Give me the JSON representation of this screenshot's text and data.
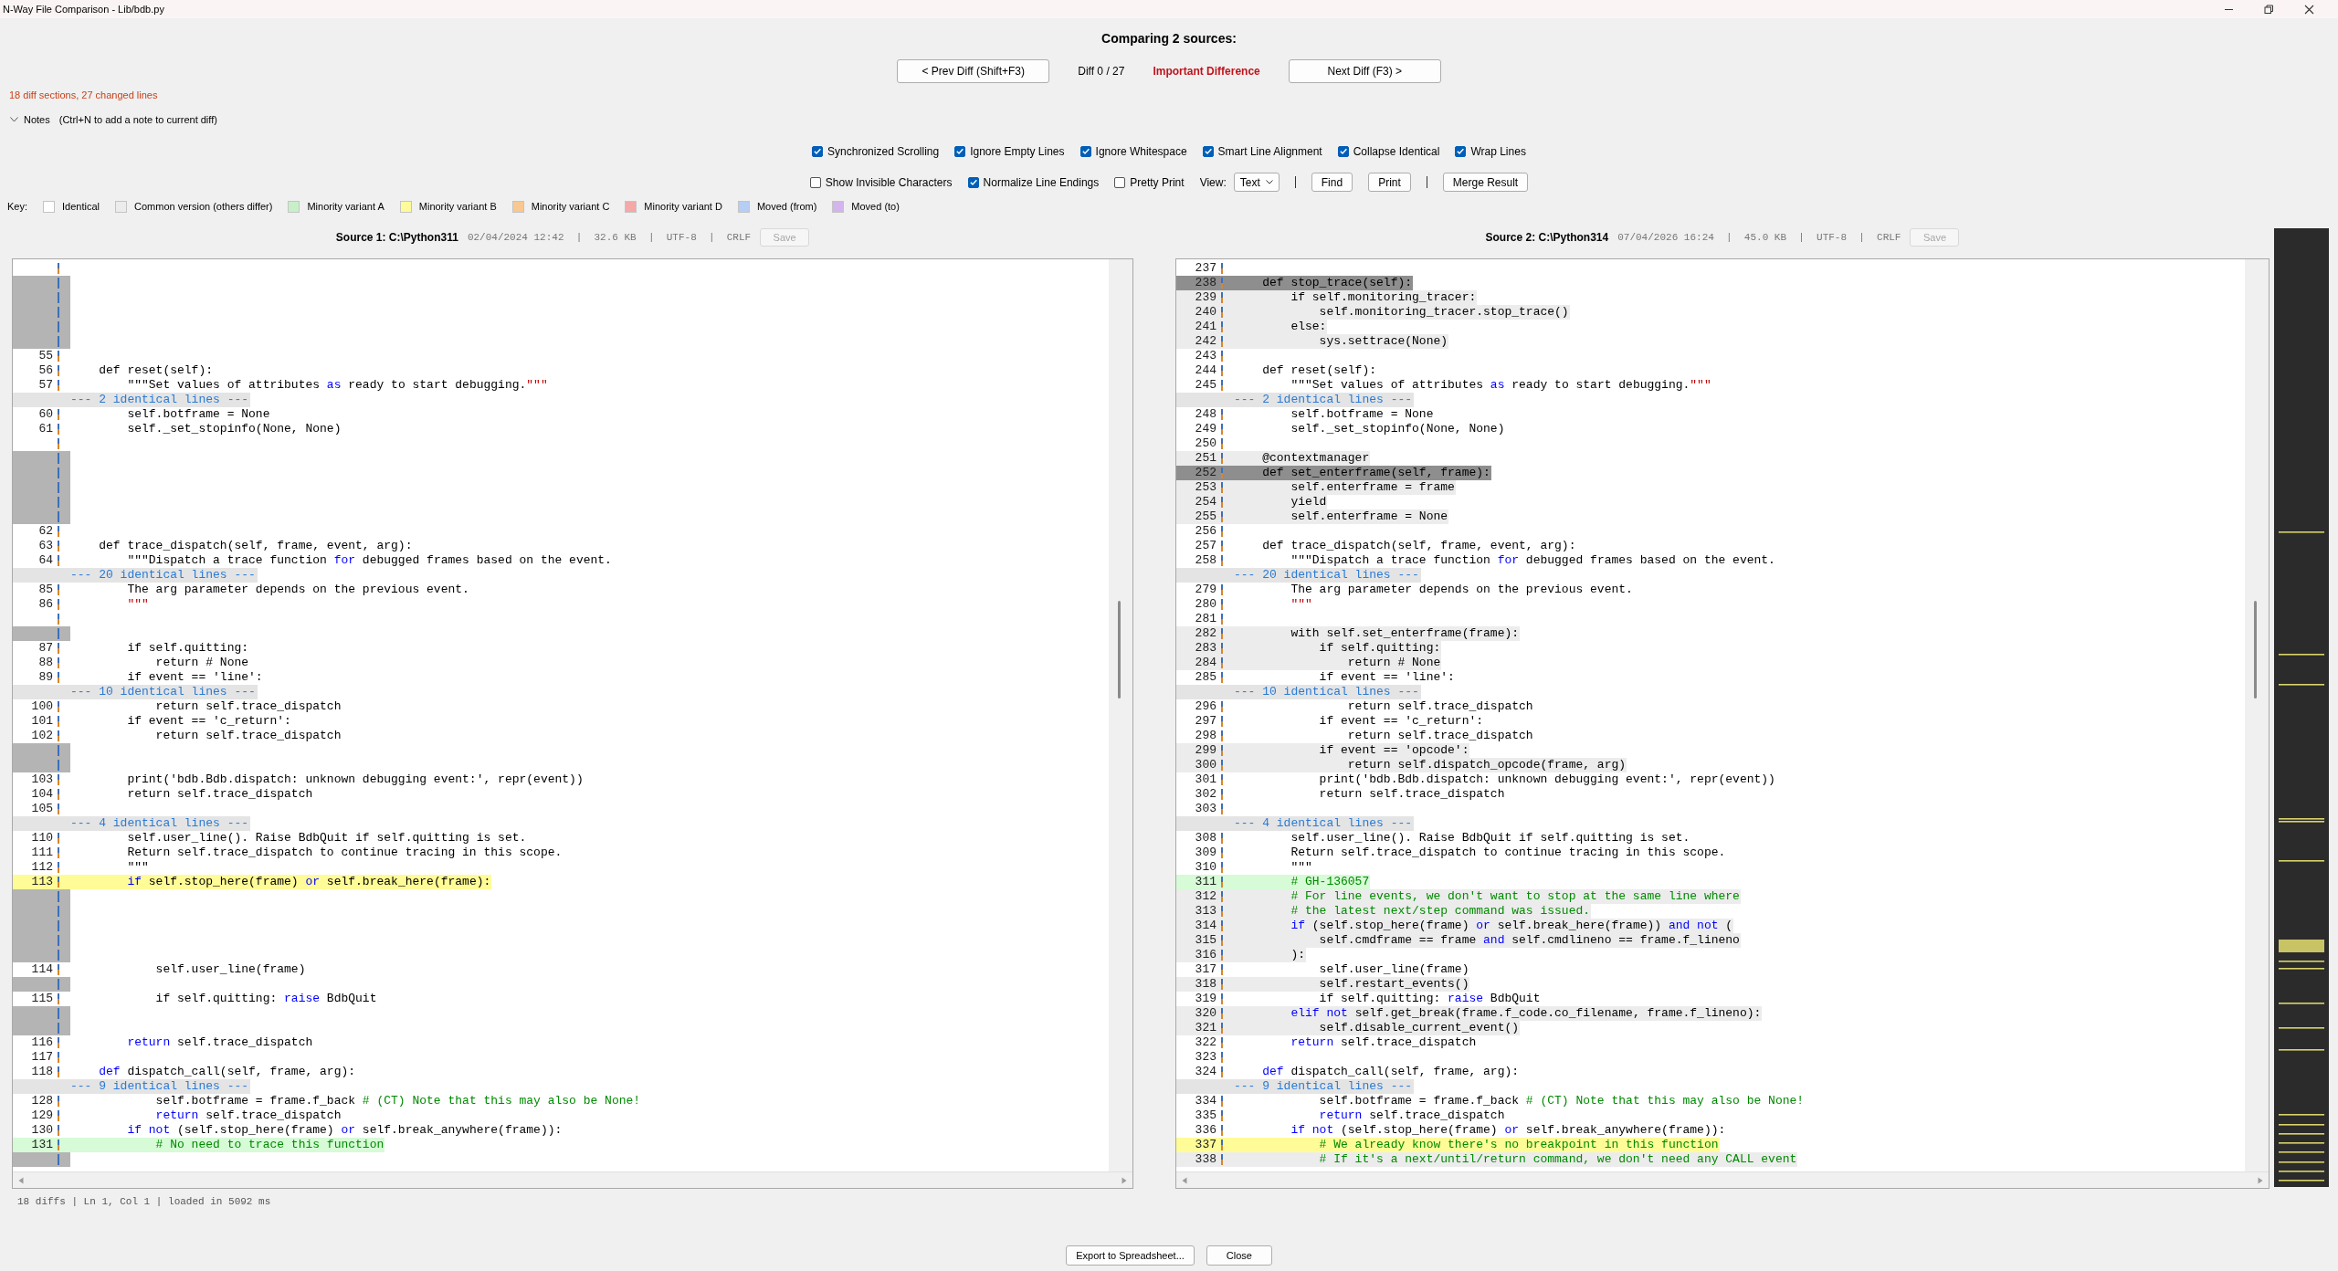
{
  "window": {
    "title": "N-Way File Comparison - Lib/bdb.py"
  },
  "header": {
    "title": "Comparing 2 sources:",
    "prev_button": "< Prev Diff  (Shift+F3)",
    "diff_counter": "Diff 0 / 27",
    "importance": "Important Difference",
    "next_button": "Next Diff (F3)  >"
  },
  "summary": "18 diff sections, 27 changed lines",
  "notes": {
    "label": "Notes",
    "hint": "(Ctrl+N to add a note to current diff)"
  },
  "options_row1": [
    {
      "label": "Synchronized Scrolling",
      "checked": true
    },
    {
      "label": "Ignore Empty Lines",
      "checked": true
    },
    {
      "label": "Ignore Whitespace",
      "checked": true
    },
    {
      "label": "Smart Line Alignment",
      "checked": true
    },
    {
      "label": "Collapse Identical",
      "checked": true
    },
    {
      "label": "Wrap Lines",
      "checked": true
    }
  ],
  "options_row2": [
    {
      "label": "Show Invisible Characters",
      "checked": false
    },
    {
      "label": "Normalize Line Endings",
      "checked": true
    },
    {
      "label": "Pretty Print",
      "checked": false
    }
  ],
  "view": {
    "label": "View:",
    "value": "Text"
  },
  "tool_buttons": [
    "Find",
    "Print",
    "Merge Result"
  ],
  "key": {
    "label": "Key:",
    "items": [
      {
        "label": "Identical",
        "color": "#ffffff"
      },
      {
        "label": "Common version (others differ)",
        "color": "#ececec"
      },
      {
        "label": "Minority variant A",
        "color": "#c8f0c8"
      },
      {
        "label": "Minority variant B",
        "color": "#fffa9a"
      },
      {
        "label": "Minority variant C",
        "color": "#f8c890"
      },
      {
        "label": "Minority variant D",
        "color": "#f4a8a8"
      },
      {
        "label": "Moved (from)",
        "color": "#b4cef4"
      },
      {
        "label": "Moved (to)",
        "color": "#d4b4ec"
      }
    ]
  },
  "sources": [
    {
      "title": "Source 1: C:\\Python311",
      "meta": "02/04/2024 12:42  |  32.6 KB  |  UTF-8  |  CRLF",
      "save": {
        "label": "Save",
        "disabled": true
      },
      "rows": [
        {
          "kind": "blank"
        },
        {
          "kind": "gap"
        },
        {
          "kind": "gap"
        },
        {
          "kind": "gap"
        },
        {
          "kind": "gap"
        },
        {
          "kind": "gap"
        },
        {
          "kind": "line",
          "number": "55"
        },
        {
          "kind": "line",
          "number": "56",
          "code": "    def reset(self):"
        },
        {
          "kind": "line",
          "number": "57",
          "parts": [
            {
              "text": "        \"\"\"Set values of attributes "
            },
            {
              "text": "as",
              "kind": "keyword"
            },
            {
              "text": " ready to start debugging."
            },
            {
              "text": "\"\"\"",
              "kind": "string"
            }
          ]
        },
        {
          "kind": "collapsed",
          "text": "--- 2 identical lines ---"
        },
        {
          "kind": "line",
          "number": "60",
          "code": "        self.botframe = None"
        },
        {
          "kind": "line",
          "number": "61",
          "code": "        self._set_stopinfo(None, None)"
        },
        {
          "kind": "blank"
        },
        {
          "kind": "gap"
        },
        {
          "kind": "gap"
        },
        {
          "kind": "gap"
        },
        {
          "kind": "gap"
        },
        {
          "kind": "gap"
        },
        {
          "kind": "line",
          "number": "62"
        },
        {
          "kind": "line",
          "number": "63",
          "code": "    def trace_dispatch(self, frame, event, arg):"
        },
        {
          "kind": "line",
          "number": "64",
          "parts": [
            {
              "text": "        \"\"\"Dispatch a trace function "
            },
            {
              "text": "for",
              "kind": "keyword"
            },
            {
              "text": " debugged frames based on the event."
            }
          ]
        },
        {
          "kind": "collapsed",
          "text": "--- 20 identical lines ---"
        },
        {
          "kind": "line",
          "number": "85",
          "code": "        The arg parameter depends on the previous event."
        },
        {
          "kind": "line",
          "number": "86",
          "parts": [
            {
              "text": "        \"\"\"",
              "kind": "string"
            }
          ]
        },
        {
          "kind": "blank"
        },
        {
          "kind": "gap"
        },
        {
          "kind": "line",
          "number": "87",
          "code": "        if self.quitting:"
        },
        {
          "kind": "line",
          "number": "88",
          "code": "            return # None"
        },
        {
          "kind": "line",
          "number": "89",
          "code": "        if event == 'line':"
        },
        {
          "kind": "collapsed",
          "text": "--- 10 identical lines ---"
        },
        {
          "kind": "line",
          "number": "100",
          "code": "            return self.trace_dispatch"
        },
        {
          "kind": "line",
          "number": "101",
          "code": "        if event == 'c_return':"
        },
        {
          "kind": "line",
          "number": "102",
          "code": "            return self.trace_dispatch"
        },
        {
          "kind": "gap"
        },
        {
          "kind": "gap"
        },
        {
          "kind": "line",
          "number": "103",
          "code": "        print('bdb.Bdb.dispatch: unknown debugging event:', repr(event))"
        },
        {
          "kind": "line",
          "number": "104",
          "code": "        return self.trace_dispatch"
        },
        {
          "kind": "line",
          "number": "105"
        },
        {
          "kind": "collapsed",
          "text": "--- 4 identical lines ---"
        },
        {
          "kind": "line",
          "number": "110",
          "code": "        self.user_line(). Raise BdbQuit if self.quitting is set."
        },
        {
          "kind": "line",
          "number": "111",
          "code": "        Return self.trace_dispatch to continue tracing in this scope."
        },
        {
          "kind": "line",
          "number": "112",
          "code": "        \"\"\""
        },
        {
          "kind": "variant-b-line",
          "number": "113",
          "parts": [
            {
              "text": "        if",
              "kind": "keyword"
            },
            {
              "text": " self.stop_here(frame) "
            },
            {
              "text": "or",
              "kind": "keyword"
            },
            {
              "text": " self.break_here(frame):"
            }
          ]
        },
        {
          "kind": "gap"
        },
        {
          "kind": "gap"
        },
        {
          "kind": "gap"
        },
        {
          "kind": "gap"
        },
        {
          "kind": "gap"
        },
        {
          "kind": "line",
          "number": "114",
          "code": "            self.user_line(frame)"
        },
        {
          "kind": "gap"
        },
        {
          "kind": "line",
          "number": "115",
          "parts": [
            {
              "text": "            if self.quitting: "
            },
            {
              "text": "raise",
              "kind": "keyword"
            },
            {
              "text": " BdbQuit"
            }
          ]
        },
        {
          "kind": "gap"
        },
        {
          "kind": "gap"
        },
        {
          "kind": "line",
          "number": "116",
          "parts": [
            {
              "text": "        return",
              "kind": "keyword"
            },
            {
              "text": " self.trace_dispatch"
            }
          ]
        },
        {
          "kind": "line",
          "number": "117"
        },
        {
          "kind": "line",
          "number": "118",
          "parts": [
            {
              "text": "    def",
              "kind": "keyword"
            },
            {
              "text": " dispatch_call(self, frame, arg):"
            }
          ]
        },
        {
          "kind": "collapsed",
          "text": "--- 9 identical lines ---"
        },
        {
          "kind": "line",
          "number": "128",
          "parts": [
            {
              "text": "            self.botframe = frame.f_back "
            },
            {
              "text": "# (CT) Note that this may also be None!",
              "kind": "comment"
            }
          ]
        },
        {
          "kind": "line",
          "number": "129",
          "parts": [
            {
              "text": "            return",
              "kind": "keyword"
            },
            {
              "text": " self.trace_dispatch"
            }
          ]
        },
        {
          "kind": "line",
          "number": "130",
          "parts": [
            {
              "text": "        if not",
              "kind": "keyword"
            },
            {
              "text": " (self.stop_here(frame) "
            },
            {
              "text": "or",
              "kind": "keyword"
            },
            {
              "text": " self.break_anywhere(frame)):"
            }
          ]
        },
        {
          "kind": "variant-a-line",
          "number": "131",
          "parts": [
            {
              "text": "            # No need to trace this function",
              "kind": "comment"
            }
          ]
        },
        {
          "kind": "gap"
        }
      ]
    },
    {
      "title": "Source 2: C:\\Python314",
      "meta": "07/04/2026 16:24  |  45.0 KB  |  UTF-8  |  CRLF",
      "save": {
        "label": "Save",
        "disabled": true
      },
      "rows": [
        {
          "kind": "line",
          "number": "237"
        },
        {
          "kind": "current-line",
          "number": "238",
          "code": "    def stop_trace(self):"
        },
        {
          "kind": "changed-line",
          "number": "239",
          "code": "        if self.monitoring_tracer:"
        },
        {
          "kind": "changed-line",
          "number": "240",
          "code": "            self.monitoring_tracer.stop_trace()"
        },
        {
          "kind": "changed-line",
          "number": "241",
          "code": "        else:"
        },
        {
          "kind": "changed-line",
          "number": "242",
          "code": "            sys.settrace(None)"
        },
        {
          "kind": "line",
          "number": "243"
        },
        {
          "kind": "line",
          "number": "244",
          "code": "    def reset(self):"
        },
        {
          "kind": "line",
          "number": "245",
          "parts": [
            {
              "text": "        \"\"\"Set values of attributes "
            },
            {
              "text": "as",
              "kind": "keyword"
            },
            {
              "text": " ready to start debugging."
            },
            {
              "text": "\"\"\"",
              "kind": "string"
            }
          ]
        },
        {
          "kind": "collapsed",
          "text": "--- 2 identical lines ---"
        },
        {
          "kind": "line",
          "number": "248",
          "code": "        self.botframe = None"
        },
        {
          "kind": "line",
          "number": "249",
          "code": "        self._set_stopinfo(None, None)"
        },
        {
          "kind": "line",
          "number": "250"
        },
        {
          "kind": "changed-line",
          "number": "251",
          "code": "    @contextmanager"
        },
        {
          "kind": "current-line",
          "number": "252",
          "code": "    def set_enterframe(self, frame):"
        },
        {
          "kind": "changed-line",
          "number": "253",
          "code": "        self.enterframe = frame"
        },
        {
          "kind": "changed-line",
          "number": "254",
          "code": "        yield"
        },
        {
          "kind": "changed-line",
          "number": "255",
          "code": "        self.enterframe = None"
        },
        {
          "kind": "line",
          "number": "256"
        },
        {
          "kind": "line",
          "number": "257",
          "code": "    def trace_dispatch(self, frame, event, arg):"
        },
        {
          "kind": "line",
          "number": "258",
          "parts": [
            {
              "text": "        \"\"\"Dispatch a trace function "
            },
            {
              "text": "for",
              "kind": "keyword"
            },
            {
              "text": " debugged frames based on the event."
            }
          ]
        },
        {
          "kind": "collapsed",
          "text": "--- 20 identical lines ---"
        },
        {
          "kind": "line",
          "number": "279",
          "code": "        The arg parameter depends on the previous event."
        },
        {
          "kind": "line",
          "number": "280",
          "parts": [
            {
              "text": "        \"\"\"",
              "kind": "string"
            }
          ]
        },
        {
          "kind": "line",
          "number": "281"
        },
        {
          "kind": "changed-line",
          "number": "282",
          "code": "        with self.set_enterframe(frame):"
        },
        {
          "kind": "changed-line",
          "number": "283",
          "code": "            if self.quitting:"
        },
        {
          "kind": "changed-line",
          "number": "284",
          "code": "                return # None"
        },
        {
          "kind": "line",
          "number": "285",
          "code": "            if event == 'line':"
        },
        {
          "kind": "collapsed",
          "text": "--- 10 identical lines ---"
        },
        {
          "kind": "line",
          "number": "296",
          "code": "                return self.trace_dispatch"
        },
        {
          "kind": "line",
          "number": "297",
          "code": "            if event == 'c_return':"
        },
        {
          "kind": "line",
          "number": "298",
          "code": "                return self.trace_dispatch"
        },
        {
          "kind": "changed-line",
          "number": "299",
          "code": "            if event == 'opcode':"
        },
        {
          "kind": "changed-line",
          "number": "300",
          "code": "                return self.dispatch_opcode(frame, arg)"
        },
        {
          "kind": "line",
          "number": "301",
          "code": "            print('bdb.Bdb.dispatch: unknown debugging event:', repr(event))"
        },
        {
          "kind": "line",
          "number": "302",
          "code": "            return self.trace_dispatch"
        },
        {
          "kind": "line",
          "number": "303"
        },
        {
          "kind": "collapsed",
          "text": "--- 4 identical lines ---"
        },
        {
          "kind": "line",
          "number": "308",
          "code": "        self.user_line(). Raise BdbQuit if self.quitting is set."
        },
        {
          "kind": "line",
          "number": "309",
          "code": "        Return self.trace_dispatch to continue tracing in this scope."
        },
        {
          "kind": "line",
          "number": "310",
          "code": "        \"\"\""
        },
        {
          "kind": "variant-a-line",
          "number": "311",
          "parts": [
            {
              "text": "        # GH-136057",
              "kind": "comment"
            }
          ]
        },
        {
          "kind": "changed-line",
          "number": "312",
          "parts": [
            {
              "text": "        # For line events, we don't want to stop at the same line where",
              "kind": "comment"
            }
          ]
        },
        {
          "kind": "changed-line",
          "number": "313",
          "parts": [
            {
              "text": "        # the latest next/step command was issued.",
              "kind": "comment"
            }
          ]
        },
        {
          "kind": "changed-line",
          "number": "314",
          "parts": [
            {
              "text": "        if",
              "kind": "keyword"
            },
            {
              "text": " (self.stop_here(frame) "
            },
            {
              "text": "or",
              "kind": "keyword"
            },
            {
              "text": " self.break_here(frame)) "
            },
            {
              "text": "and not",
              "kind": "keyword"
            },
            {
              "text": " ("
            }
          ]
        },
        {
          "kind": "changed-line",
          "number": "315",
          "parts": [
            {
              "text": "            self.cmdframe == frame "
            },
            {
              "text": "and",
              "kind": "keyword"
            },
            {
              "text": " self.cmdlineno == frame.f_lineno"
            }
          ]
        },
        {
          "kind": "changed-line",
          "number": "316",
          "code": "        ):"
        },
        {
          "kind": "line",
          "number": "317",
          "code": "            self.user_line(frame)"
        },
        {
          "kind": "changed-line",
          "number": "318",
          "code": "            self.restart_events()"
        },
        {
          "kind": "line",
          "number": "319",
          "parts": [
            {
              "text": "            if self.quitting: "
            },
            {
              "text": "raise",
              "kind": "keyword"
            },
            {
              "text": " BdbQuit"
            }
          ]
        },
        {
          "kind": "changed-line",
          "number": "320",
          "parts": [
            {
              "text": "        elif not",
              "kind": "keyword"
            },
            {
              "text": " self.get_break(frame.f_code.co_filename, frame.f_lineno):"
            }
          ]
        },
        {
          "kind": "changed-line",
          "number": "321",
          "code": "            self.disable_current_event()"
        },
        {
          "kind": "line",
          "number": "322",
          "parts": [
            {
              "text": "        return",
              "kind": "keyword"
            },
            {
              "text": " self.trace_dispatch"
            }
          ]
        },
        {
          "kind": "line",
          "number": "323"
        },
        {
          "kind": "line",
          "number": "324",
          "parts": [
            {
              "text": "    def",
              "kind": "keyword"
            },
            {
              "text": " dispatch_call(self, frame, arg):"
            }
          ]
        },
        {
          "kind": "collapsed",
          "text": "--- 9 identical lines ---"
        },
        {
          "kind": "line",
          "number": "334",
          "parts": [
            {
              "text": "            self.botframe = frame.f_back "
            },
            {
              "text": "# (CT) Note that this may also be None!",
              "kind": "comment"
            }
          ]
        },
        {
          "kind": "line",
          "number": "335",
          "parts": [
            {
              "text": "            return",
              "kind": "keyword"
            },
            {
              "text": " self.trace_dispatch"
            }
          ]
        },
        {
          "kind": "line",
          "number": "336",
          "parts": [
            {
              "text": "        if not",
              "kind": "keyword"
            },
            {
              "text": " (self.stop_here(frame) "
            },
            {
              "text": "or",
              "kind": "keyword"
            },
            {
              "text": " self.break_anywhere(frame)):"
            }
          ]
        },
        {
          "kind": "variant-b-line",
          "number": "337",
          "parts": [
            {
              "text": "            # We already know there's no breakpoint in this function",
              "kind": "comment"
            }
          ]
        },
        {
          "kind": "changed-line",
          "number": "338",
          "parts": [
            {
              "text": "            # If it's a next/until/return command, we don't need any CALL event",
              "kind": "comment"
            }
          ]
        }
      ]
    }
  ],
  "status": "18 diffs | Ln 1, Col 1 | loaded in 5092 ms",
  "dialog_buttons": [
    "Export to Spreadsheet...",
    "Close"
  ]
}
